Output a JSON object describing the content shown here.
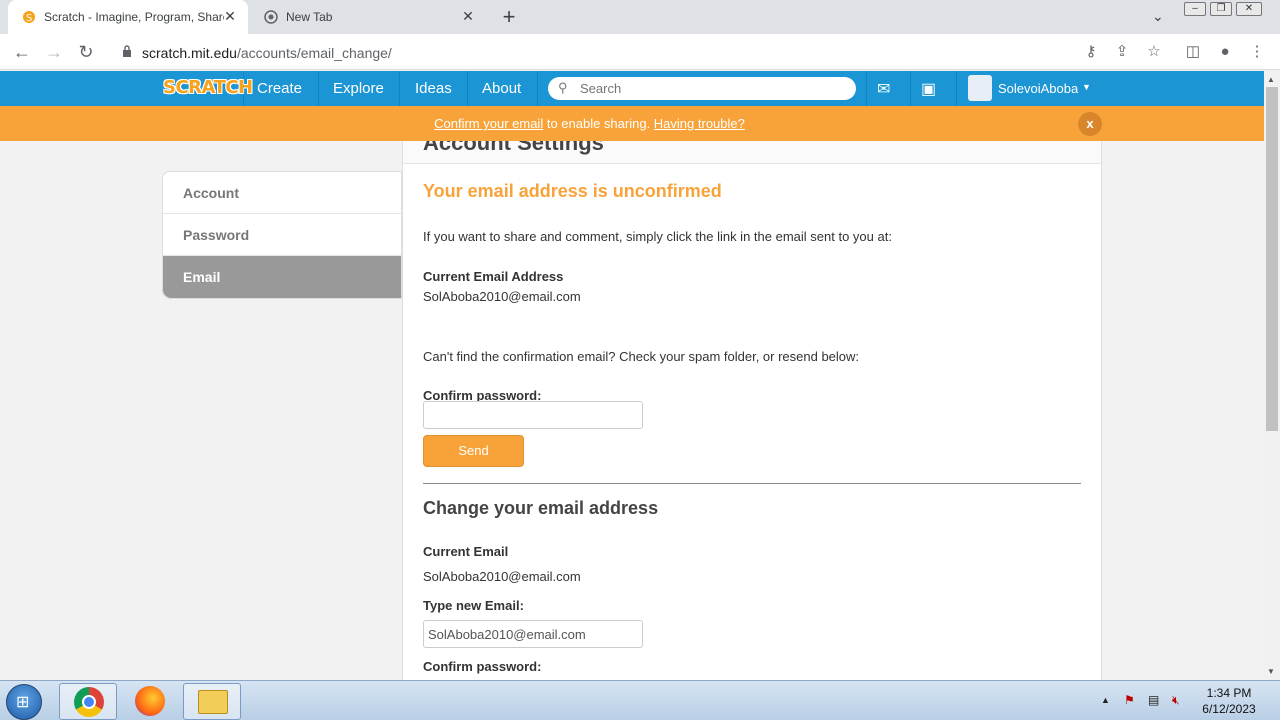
{
  "browser": {
    "tabs": [
      {
        "title": "Scratch - Imagine, Program, Share",
        "close": "✕"
      },
      {
        "title": "New Tab",
        "close": "✕"
      }
    ],
    "new_tab": "+",
    "url_host": "scratch.mit.edu",
    "url_path": "/accounts/email_change/"
  },
  "scratch_nav": {
    "logo": "SCRATCH",
    "links": [
      "Create",
      "Explore",
      "Ideas",
      "About"
    ],
    "search_placeholder": "Search",
    "username": "SolevoiAboba"
  },
  "banner": {
    "confirm_link": "Confirm your email",
    "middle": " to enable sharing. ",
    "trouble_link": "Having trouble?",
    "close": "x"
  },
  "sidebar": {
    "items": [
      {
        "label": "Account"
      },
      {
        "label": "Password"
      },
      {
        "label": "Email"
      }
    ]
  },
  "main": {
    "heading": "Account Settings",
    "warning": "Your email address is unconfirmed",
    "intro": "If you want to share and comment, simply click the link in the email sent to you at:",
    "current_email_label": "Current Email Address",
    "current_email": "SolAboba2010@email.com",
    "resend_text": "Can't find the confirmation email? Check your spam folder, or resend below:",
    "confirm_password_label": "Confirm password:",
    "send_button": "Send",
    "change_heading": "Change your email address",
    "current_email_label2": "Current Email",
    "current_email2": "SolAboba2010@email.com",
    "new_email_label": "Type new Email:",
    "new_email_value": "SolAboba2010@email.com",
    "confirm_password_label2": "Confirm password:"
  },
  "taskbar": {
    "time": "1:34 PM",
    "date": "6/12/2023"
  },
  "colors": {
    "scratch_blue": "#1b95d4",
    "banner_orange": "#f7a33a"
  }
}
